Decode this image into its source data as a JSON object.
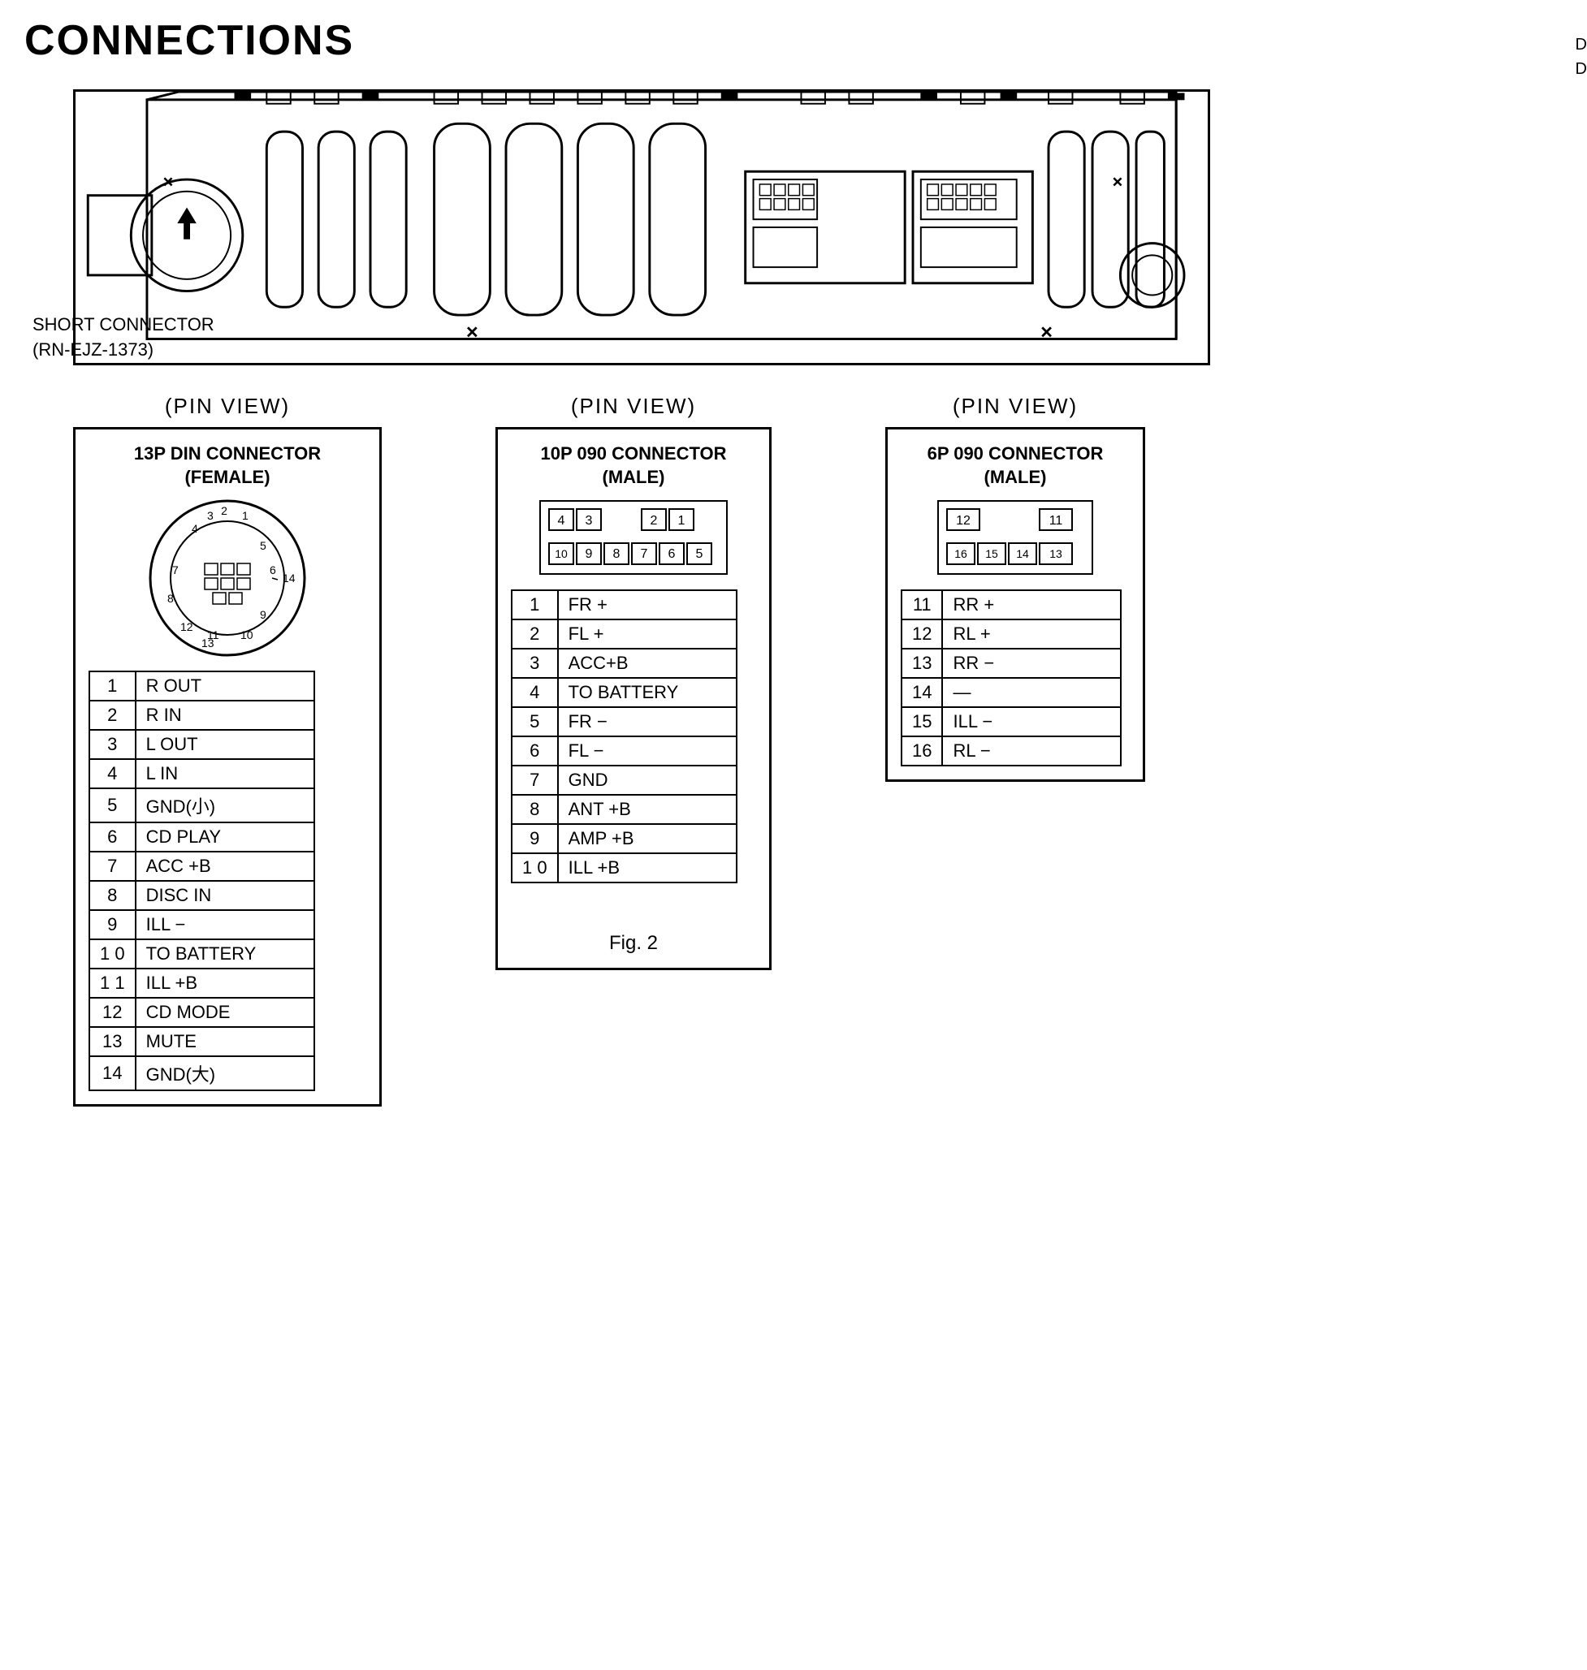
{
  "title": "CONNECTIONS",
  "top_right_note": [
    "D",
    "D"
  ],
  "short_connector_label": "SHORT CONNECTOR\n(RN-EJZ-1373)",
  "fig_label": "Fig. 2",
  "pin_views": [
    {
      "label": "(PIN  VIEW)",
      "connector_title": "13P DIN CONNECTOR\n(FEMALE)",
      "rows": [
        {
          "pin": "1",
          "signal": "R OUT"
        },
        {
          "pin": "2",
          "signal": "R IN"
        },
        {
          "pin": "3",
          "signal": "L OUT"
        },
        {
          "pin": "4",
          "signal": "L IN"
        },
        {
          "pin": "5",
          "signal": "GND(小)"
        },
        {
          "pin": "6",
          "signal": "CD PLAY"
        },
        {
          "pin": "7",
          "signal": "ACC +B"
        },
        {
          "pin": "8",
          "signal": "DISC IN"
        },
        {
          "pin": "9",
          "signal": "ILL −"
        },
        {
          "pin": "1 0",
          "signal": "TO BATTERY"
        },
        {
          "pin": "1 1",
          "signal": "ILL +B"
        },
        {
          "pin": "12",
          "signal": "CD MODE"
        },
        {
          "pin": "13",
          "signal": "MUTE"
        },
        {
          "pin": "14",
          "signal": "GND(大)"
        }
      ]
    },
    {
      "label": "(PIN  VIEW)",
      "connector_title": "10P 090 CONNECTOR\n(MALE)",
      "pin_diagram_rows": [
        [
          "4",
          "3",
          "",
          "2",
          "1"
        ],
        [
          "10",
          "9",
          "8",
          "7",
          "6",
          "5"
        ]
      ],
      "rows": [
        {
          "pin": "1",
          "signal": "FR +"
        },
        {
          "pin": "2",
          "signal": "FL +"
        },
        {
          "pin": "3",
          "signal": "ACC+B"
        },
        {
          "pin": "4",
          "signal": "TO BATTERY"
        },
        {
          "pin": "5",
          "signal": "FR −"
        },
        {
          "pin": "6",
          "signal": "FL −"
        },
        {
          "pin": "7",
          "signal": "GND"
        },
        {
          "pin": "8",
          "signal": "ANT +B"
        },
        {
          "pin": "9",
          "signal": "AMP +B"
        },
        {
          "pin": "1 0",
          "signal": "ILL +B"
        }
      ]
    },
    {
      "label": "(PIN  VIEW)",
      "connector_title": "6P 090 CONNECTOR\n(MALE)",
      "pin_diagram_rows": [
        [
          "12",
          "",
          "11"
        ],
        [
          "16",
          "15",
          "14",
          "13"
        ]
      ],
      "rows": [
        {
          "pin": "11",
          "signal": "RR +"
        },
        {
          "pin": "12",
          "signal": "RL +"
        },
        {
          "pin": "13",
          "signal": "RR −"
        },
        {
          "pin": "14",
          "signal": "—"
        },
        {
          "pin": "15",
          "signal": "ILL −"
        },
        {
          "pin": "16",
          "signal": "RL −"
        }
      ]
    }
  ]
}
